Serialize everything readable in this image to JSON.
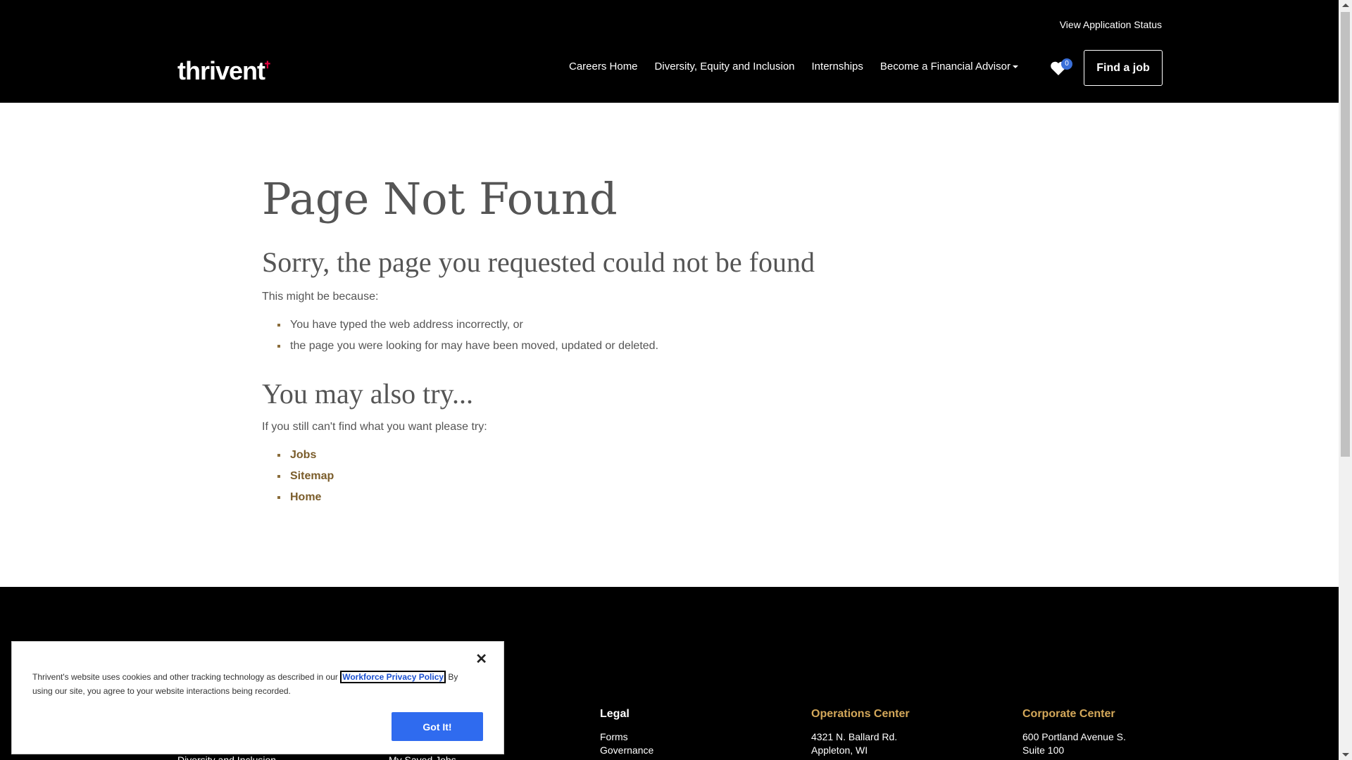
{
  "header": {
    "top_link": "View Application Status",
    "logo_text": "thrivent",
    "nav": [
      {
        "label": "Careers Home"
      },
      {
        "label": "Diversity, Equity and Inclusion"
      },
      {
        "label": "Internships"
      },
      {
        "label": "Become a Financial Advisor"
      }
    ],
    "saved_count": "0",
    "cta": "Find a job",
    "brand_color": "#e0003d"
  },
  "main": {
    "title": "Page Not Found",
    "subtitle": "Sorry, the page you requested could not be found",
    "intro": "This might be because:",
    "reasons": [
      "You have typed the web address incorrectly, or",
      "the page you were looking for may have been moved, updated or deleted."
    ],
    "also_try_title": "You may also try...",
    "also_try_intro": "If you still can't find what you want please try:",
    "links": [
      "Jobs",
      "Sitemap",
      "Home"
    ]
  },
  "footer": {
    "legal": {
      "heading": "Legal",
      "items": [
        "Forms",
        "Governance"
      ]
    },
    "operations": {
      "heading": "Operations Center",
      "lines": [
        "4321 N. Ballard Rd.",
        "Appleton, WI"
      ]
    },
    "corporate": {
      "heading": "Corporate Center",
      "lines": [
        "600 Portland Avenue S.",
        "Suite 100"
      ]
    },
    "partial_left": "Diversity and Inclusion",
    "partial_mid": "My Saved Jobs"
  },
  "cookie": {
    "text_before": "Thrivent's website uses cookies and other tracking technology as described in our",
    "link": "Workforce Privacy Policy",
    "text_after": "By using our site, you agree to your website interactions being recorded.",
    "button": "Got It!",
    "close": "✕"
  }
}
